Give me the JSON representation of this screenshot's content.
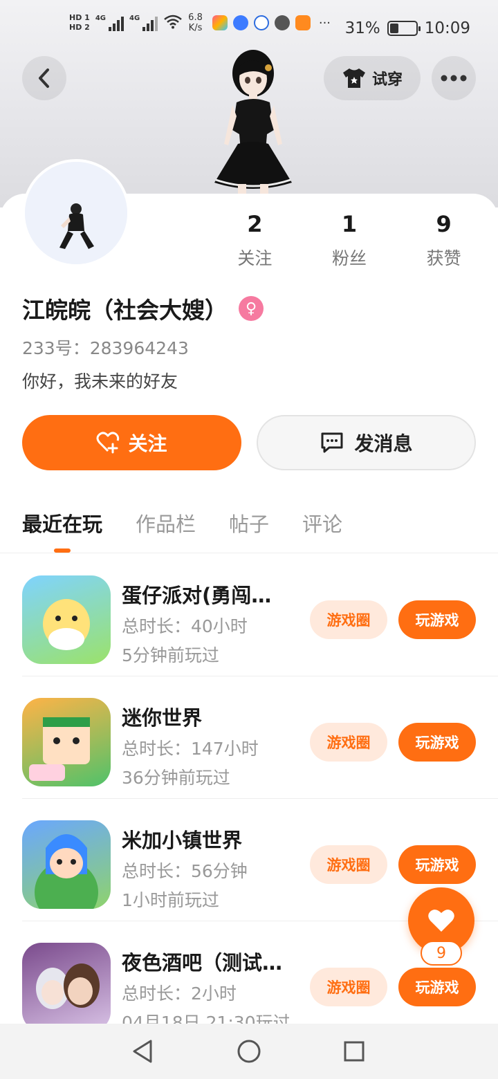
{
  "status_bar": {
    "hd1": "HD 1",
    "hd2": "HD 2",
    "net1": "4G",
    "net2": "4G",
    "speed_value": "6.8",
    "speed_unit": "K/s",
    "more": "···",
    "battery": "31%",
    "time": "10:09"
  },
  "header": {
    "back_icon": "chevron-left-icon",
    "tryon_label": "试穿",
    "more_icon": "more-dots-icon"
  },
  "profile": {
    "stats": [
      {
        "num": "2",
        "label": "关注"
      },
      {
        "num": "1",
        "label": "粉丝"
      },
      {
        "num": "9",
        "label": "获赞"
      }
    ],
    "name": "江皖皖（社会大嫂）",
    "gender_symbol": "♀",
    "uid": "233号：283964243",
    "bio": "你好，我未来的好友",
    "follow_label": "关注",
    "message_label": "发消息"
  },
  "tabs": [
    "最近在玩",
    "作品栏",
    "帖子",
    "评论"
  ],
  "games": [
    {
      "title": "蛋仔派对(勇闯…",
      "duration": "总时长：40小时",
      "last": "5分钟前玩过",
      "circle": "游戏圈",
      "play": "玩游戏",
      "colors": [
        "#7fd3ff",
        "#9be26a"
      ]
    },
    {
      "title": "迷你世界",
      "duration": "总时长：147小时",
      "last": "36分钟前玩过",
      "circle": "游戏圈",
      "play": "玩游戏",
      "colors": [
        "#ffb347",
        "#4fc26a"
      ]
    },
    {
      "title": "米加小镇世界",
      "duration": "总时长：56分钟",
      "last": "1小时前玩过",
      "circle": "游戏圈",
      "play": "玩游戏",
      "colors": [
        "#6aa7ff",
        "#8fd36b"
      ]
    },
    {
      "title": "夜色酒吧（测试…",
      "duration": "总时长：2小时",
      "last": "04月18日 21:30玩过",
      "circle": "游戏圈",
      "play": "玩游戏",
      "colors": [
        "#7a4a8c",
        "#d9c3e6"
      ]
    }
  ],
  "likes": "9",
  "colors": {
    "accent": "#ff6e12",
    "accent_light": "#ffe9dc",
    "gender": "#f67aa0"
  }
}
